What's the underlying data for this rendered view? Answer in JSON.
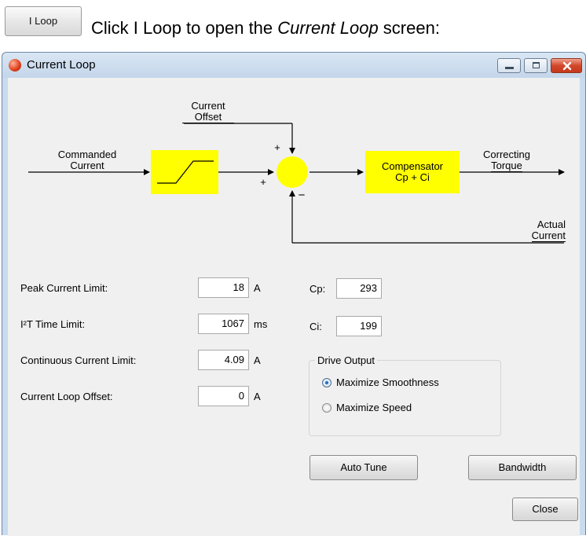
{
  "instruction": {
    "button_label": "I Loop",
    "text_before": "Click I Loop to open the ",
    "text_italic": "Current Loop",
    "text_after": " screen:"
  },
  "window": {
    "title": "Current Loop",
    "controls": [
      "minimize-icon",
      "maximize-icon",
      "close-icon"
    ]
  },
  "diagram": {
    "commanded_current_1": "Commanded",
    "commanded_current_2": "Current",
    "current_offset_1": "Current",
    "current_offset_2": "Offset",
    "plus_top": "+",
    "plus_left": "+",
    "minus": "−",
    "compensator_1": "Compensator",
    "compensator_2": "Cp + Ci",
    "correcting_torque_1": "Correcting",
    "correcting_torque_2": "Torque",
    "actual_current_1": "Actual",
    "actual_current_2": "Current",
    "colors": {
      "block": "#ffff00",
      "line": "#000000"
    }
  },
  "form": {
    "peak_current_limit": {
      "label": "Peak Current Limit:",
      "value": "18",
      "unit": "A"
    },
    "i2t_time_limit": {
      "label": "I²T Time Limit:",
      "value": "1067",
      "unit": "ms"
    },
    "continuous_current_limit": {
      "label": "Continuous Current Limit:",
      "value": "4.09",
      "unit": "A"
    },
    "current_loop_offset": {
      "label": "Current Loop Offset:",
      "value": "0",
      "unit": "A"
    },
    "cp": {
      "label": "Cp:",
      "value": "293"
    },
    "ci": {
      "label": "Ci:",
      "value": "199"
    }
  },
  "drive_output": {
    "title": "Drive Output",
    "options": [
      {
        "label": "Maximize Smoothness",
        "selected": true
      },
      {
        "label": "Maximize Speed",
        "selected": false
      }
    ]
  },
  "buttons": {
    "auto_tune": "Auto Tune",
    "bandwidth": "Bandwidth",
    "close": "Close"
  }
}
